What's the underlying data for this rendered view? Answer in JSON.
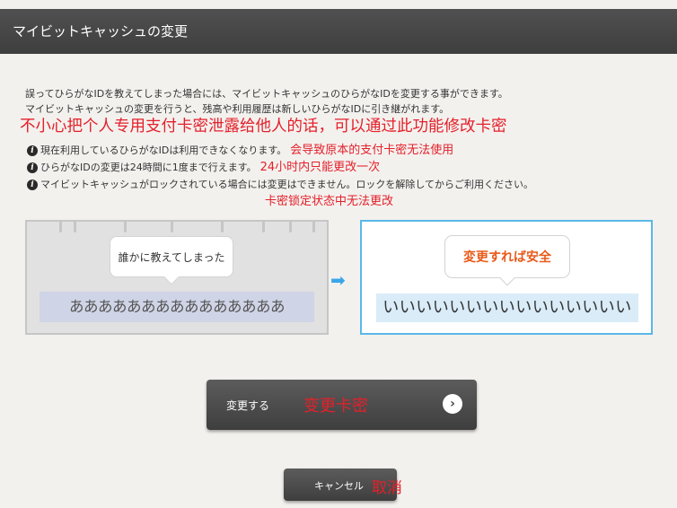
{
  "header": {
    "title": "マイビットキャッシュの変更"
  },
  "intro": {
    "line1": "誤ってひらがなIDを教えてしまった場合には、マイビットキャッシュのひらがなIDを変更する事ができます。",
    "line2": "マイビットキャッシュの変更を行うと、残高や利用履歴は新しいひらがなIDに引き継がれます。"
  },
  "note_zh": "不小心把个人专用支付卡密泄露给他人的话，可以通过此功能修改卡密",
  "info": [
    {
      "text": "現在利用しているひらがなIDは利用できなくなります。",
      "note": "会导致原本的支付卡密无法使用"
    },
    {
      "text": "ひらがなIDの変更は24時間に1度まで行えます。",
      "note": "24小时内只能更改一次"
    },
    {
      "text": "マイビットキャッシュがロックされている場合には変更はできません。ロックを解除してからご利用ください。",
      "note": ""
    }
  ],
  "lock_note": "卡密锁定状态中无法更改",
  "illustration": {
    "left_bubble": "誰かに教えてしまった",
    "left_kana": "あああああああああああああああ",
    "right_bubble": "変更すれば安全",
    "right_kana": "いいいいいいいいいいいいいいい"
  },
  "buttons": {
    "change_label": "変更する",
    "change_note": "变更卡密",
    "cancel_label": "キャンセル",
    "cancel_note": "取消"
  },
  "colors": {
    "accent_red": "#e4202a",
    "bubble_orange": "#e85a1a",
    "panel_blue": "#5ab8e8"
  }
}
